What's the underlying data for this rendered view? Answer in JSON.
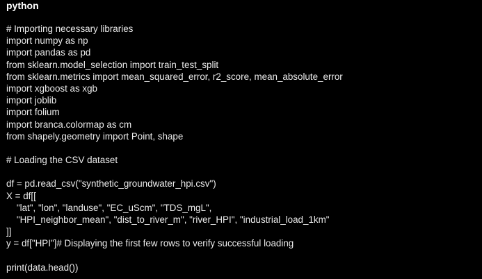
{
  "colors": {
    "background": "#000000",
    "text": "#ececec",
    "label": "#ffffff"
  },
  "code_block": {
    "language": "python",
    "lines": [
      "# Importing necessary libraries",
      "import numpy as np",
      "import pandas as pd",
      "from sklearn.model_selection import train_test_split",
      "from sklearn.metrics import mean_squared_error, r2_score, mean_absolute_error",
      "import xgboost as xgb",
      "import joblib",
      "import folium",
      "import branca.colormap as cm",
      "from shapely.geometry import Point, shape",
      "",
      "# Loading the CSV dataset",
      "",
      "df = pd.read_csv(\"synthetic_groundwater_hpi.csv\")",
      "X = df[[",
      "    \"lat\", \"lon\", \"landuse\", \"EC_uScm\", \"TDS_mgL\",",
      "    \"HPI_neighbor_mean\", \"dist_to_river_m\", \"river_HPI\", \"industrial_load_1km\"",
      "]]",
      "y = df[\"HPI\"]# Displaying the first few rows to verify successful loading",
      "",
      "print(data.head())"
    ]
  }
}
